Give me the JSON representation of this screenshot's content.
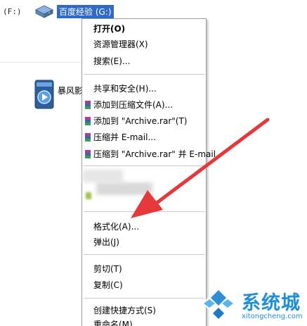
{
  "desktop": {
    "drive_f_label": "(F:)",
    "drive_g_label": "百度经验 (G:)",
    "app_label": "暴风影视",
    "drive_icon": "drive-icon",
    "app_icon": "media-player-icon"
  },
  "context_menu": {
    "items": [
      {
        "label": "打开(O)"
      },
      {
        "label": "资源管理器(X)"
      },
      {
        "label": "搜索(E)..."
      },
      {
        "label": "共享和安全(H)..."
      },
      {
        "label": "添加到压缩文件(A)..."
      },
      {
        "label": "添加到 \"Archive.rar\"(T)"
      },
      {
        "label": "压缩并 E-mail..."
      },
      {
        "label": "压缩到 \"Archive.rar\" 并 E-mail"
      },
      {
        "label": "格式化(A)..."
      },
      {
        "label": "弹出(J)"
      },
      {
        "label": "剪切(T)"
      },
      {
        "label": "复制(C)"
      },
      {
        "label": "创建快捷方式(S)"
      },
      {
        "label": "重命名(M)"
      }
    ],
    "rar_icon": "winrar-icon"
  },
  "watermark": {
    "text": "系统城",
    "url": "xitongcheng.com",
    "icon": "windows-logo-icon"
  },
  "colors": {
    "selection": "#316ac5",
    "arrow": "#e5383b",
    "watermark": "#1d8fd9"
  }
}
